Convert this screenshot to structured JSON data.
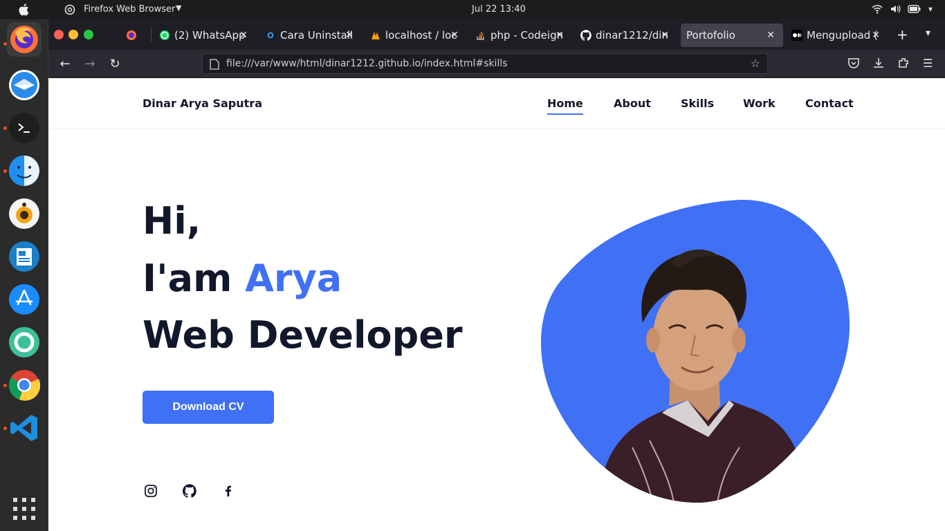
{
  "system_bar": {
    "app_title": "Firefox Web Browser",
    "clock": "Jul 22  13:40"
  },
  "dock": {
    "items": [
      "firefox-icon",
      "mail-icon",
      "terminal-icon",
      "finder-icon",
      "music-player-icon",
      "document-viewer-icon",
      "app-store-icon",
      "help-icon",
      "chrome-icon",
      "vscode-icon"
    ]
  },
  "tabs": [
    {
      "label": "",
      "icon": "firefox-icon"
    },
    {
      "label": "(2) WhatsApp",
      "icon": "whatsapp-icon"
    },
    {
      "label": "Cara Uninstall",
      "icon": "site-icon"
    },
    {
      "label": "localhost / loc",
      "icon": "phpmyadmin-icon"
    },
    {
      "label": "php - Codeign",
      "icon": "stackoverflow-icon"
    },
    {
      "label": "dinar1212/din",
      "icon": "github-icon"
    },
    {
      "label": "Portofolio",
      "icon": "",
      "active": true
    },
    {
      "label": "Mengupload (",
      "icon": "medium-icon"
    }
  ],
  "navbar": {
    "url": "file:///var/www/html/dinar1212.github.io/index.html#skills"
  },
  "site": {
    "brand": "Dinar Arya Saputra",
    "menu": [
      "Home",
      "About",
      "Skills",
      "Work",
      "Contact"
    ],
    "hero": {
      "line1": "Hi,",
      "line2_prefix": "I'am ",
      "line2_accent": "Arya",
      "line3": "Web Developer"
    },
    "cta": "Download CV",
    "social": [
      "instagram-icon",
      "github-icon",
      "facebook-icon"
    ],
    "accent_color": "#4070f4"
  }
}
